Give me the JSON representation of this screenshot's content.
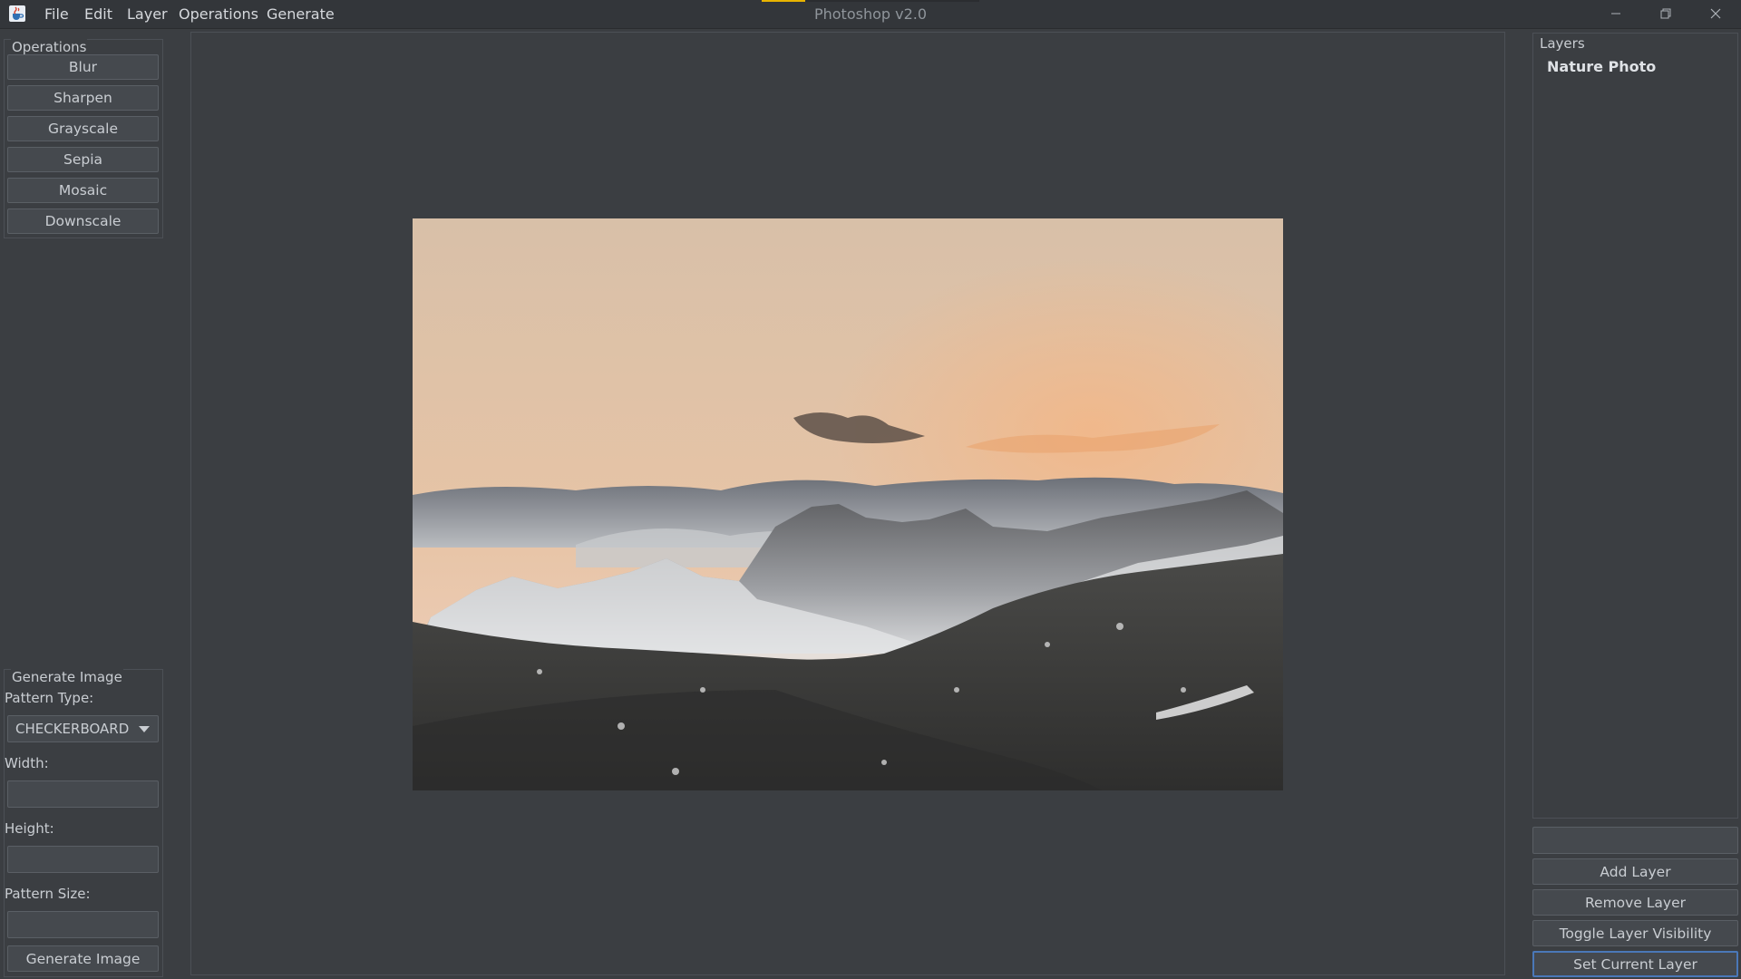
{
  "window": {
    "title": "Photoshop v2.0",
    "app_icon": "java-cup-icon"
  },
  "menu": [
    {
      "label": "File"
    },
    {
      "label": "Edit"
    },
    {
      "label": "Layer"
    },
    {
      "label": "Operations"
    },
    {
      "label": "Generate"
    }
  ],
  "window_controls": {
    "minimize": "minimize-icon",
    "maximize": "restore-icon",
    "close": "close-icon"
  },
  "operations": {
    "title": "Operations",
    "buttons": [
      "Blur",
      "Sharpen",
      "Grayscale",
      "Sepia",
      "Mosaic",
      "Downscale"
    ]
  },
  "generate": {
    "title": "Generate Image",
    "pattern_type_label": "Pattern Type:",
    "pattern_type_value": "CHECKERBOARD",
    "width_label": "Width:",
    "width_value": "",
    "height_label": "Height:",
    "height_value": "",
    "pattern_size_label": "Pattern Size:",
    "pattern_size_value": "",
    "button": "Generate Image"
  },
  "canvas": {
    "image_description_icon": "mountain-landscape-photo"
  },
  "layers": {
    "title": "Layers",
    "items": [
      {
        "name": "Nature Photo"
      }
    ],
    "name_input_value": "",
    "buttons": {
      "add": "Add Layer",
      "remove": "Remove Layer",
      "toggle": "Toggle Layer Visibility",
      "set_current": "Set Current Layer"
    }
  },
  "colors": {
    "background": "#3b3e42",
    "focus_accent": "#4a78b8",
    "title_accent": "#e8b400"
  }
}
